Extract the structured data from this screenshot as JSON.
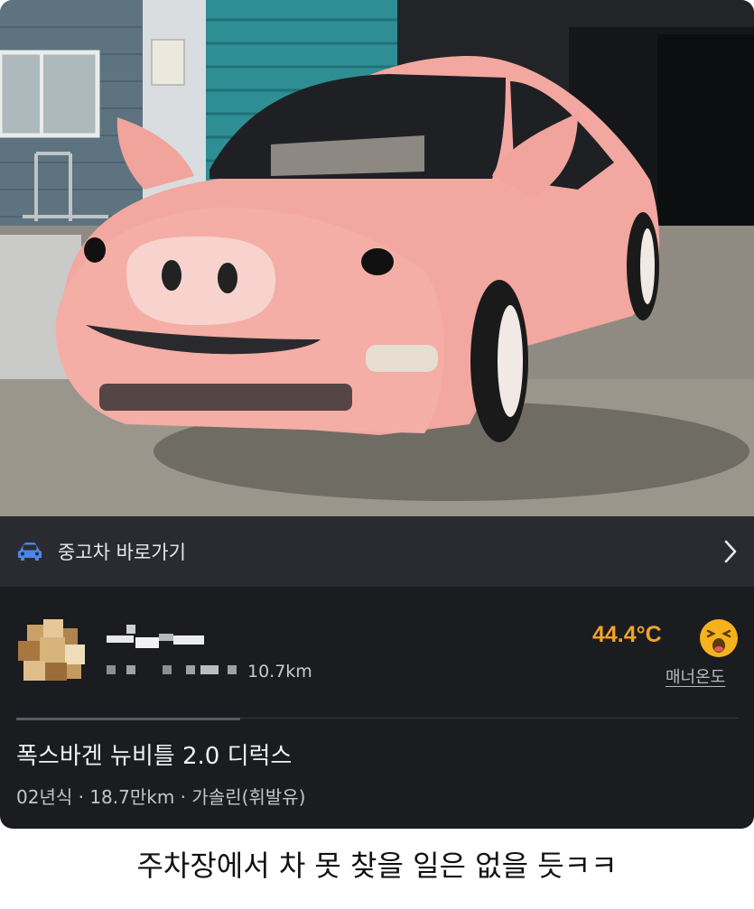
{
  "shortcut": {
    "label": "중고차 바로가기"
  },
  "seller": {
    "distance": "10.7km",
    "temperature": "44.4°C",
    "manner_label": "매너온도"
  },
  "listing": {
    "title": "폭스바겐 뉴비틀 2.0 디럭스",
    "meta": "02년식 · 18.7만km · 가솔린(휘발유)"
  },
  "caption": "주차장에서 차 못 찾을 일은 없을 듯ㅋㅋ",
  "icons": {
    "shortcut": "car-icon",
    "chevron": "chevron-right-icon",
    "temperature": "laughing-face-icon"
  },
  "colors": {
    "car_body": "#f2a7a0",
    "temperature": "#f0a32a",
    "card_bg": "#1b1c20"
  }
}
